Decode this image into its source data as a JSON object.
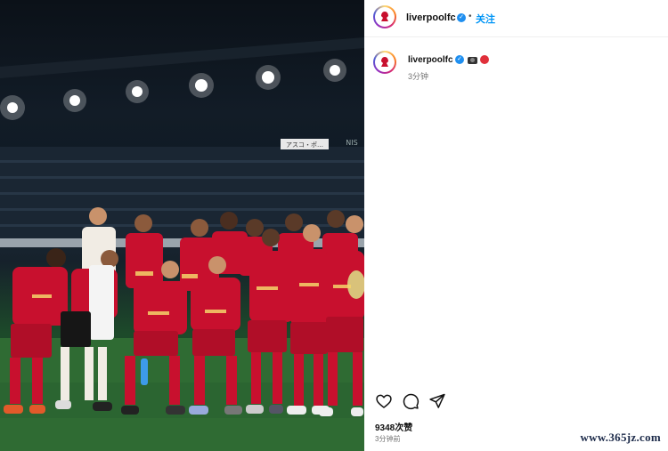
{
  "post": {
    "username": "liverpoolfc",
    "follow_label": "关注",
    "separator": "•",
    "caption_time": "3分钟",
    "likes": "9348次赞",
    "post_time": "3分钟前",
    "verified_color": "#1f8ff0",
    "follow_color": "#0095f6"
  },
  "photo": {
    "stadium_boards": [
      "アスコ・ポ…",
      "NIS"
    ]
  },
  "watermark": "www.365jz.com",
  "icons": {
    "like": "heart-icon",
    "comment": "comment-icon",
    "share": "send-icon",
    "verified": "verified-badge-icon",
    "camera": "camera-emoji-icon",
    "red_circle": "red-circle-emoji-icon"
  },
  "colors": {
    "kit_red": "#c8102e",
    "pitch_green": "#2f6b33"
  }
}
